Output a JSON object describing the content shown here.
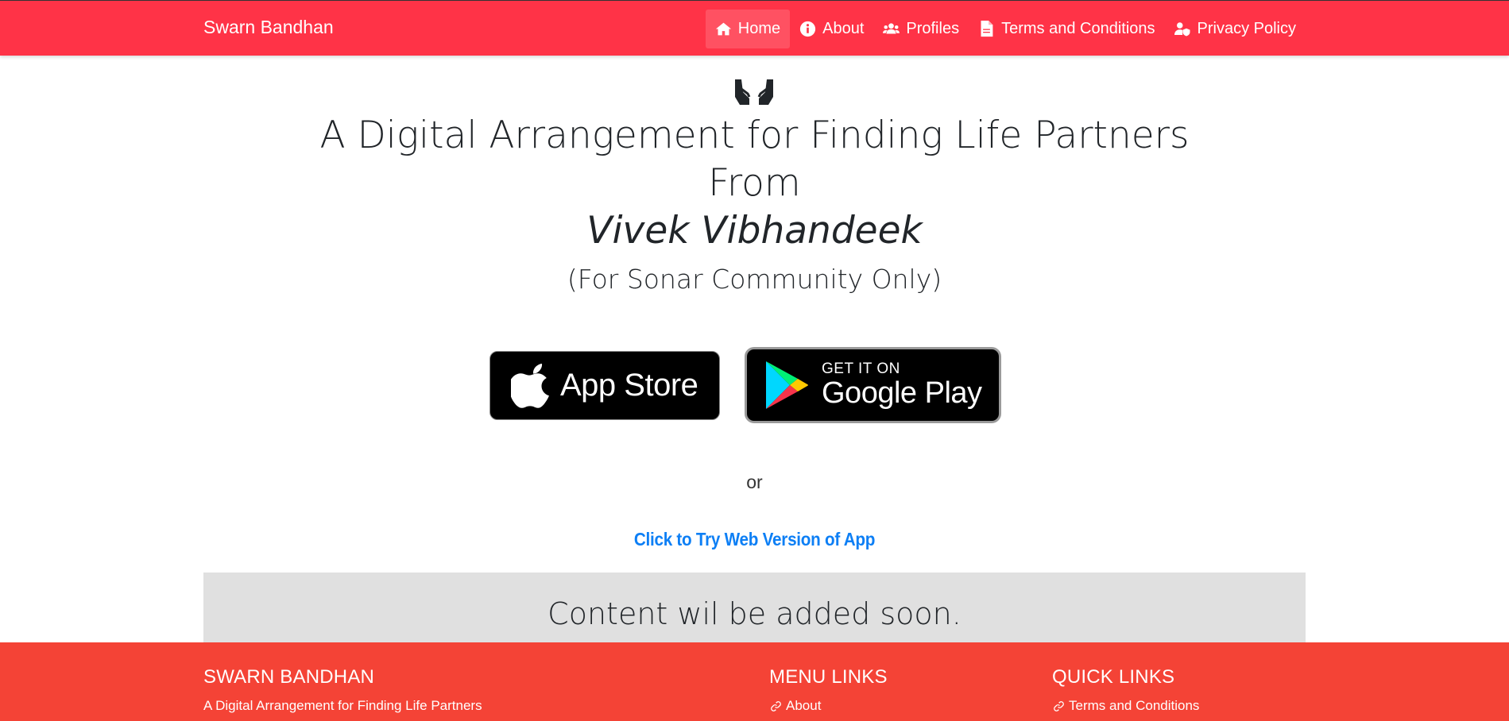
{
  "brand": "Swarn Bandhan",
  "nav": [
    {
      "label": "Home",
      "icon": "home-icon",
      "active": true
    },
    {
      "label": "About",
      "icon": "info-icon"
    },
    {
      "label": "Profiles",
      "icon": "users-icon"
    },
    {
      "label": "Terms and Conditions",
      "icon": "document-icon"
    },
    {
      "label": "Privacy Policy",
      "icon": "user-shield-icon"
    }
  ],
  "hero": {
    "line1": "A Digital Arrangement for Finding Life Partners",
    "line2": "From",
    "line3": "Vivek Vibhandeek",
    "line4": "(For Sonar Community Only)"
  },
  "badges": {
    "appstore": "App Store",
    "play_small": "GET IT ON",
    "play_big": "Google Play"
  },
  "or_text": "or",
  "web_link": "Click to Try Web Version of App",
  "content_placeholder": "Content wil be added soon.",
  "footer": {
    "col1_heading": "SWARN BANDHAN",
    "col1_text": "A Digital Arrangement for Finding Life Partners",
    "col2_heading": "MENU LINKS",
    "col2_link": "About",
    "col3_heading": "QUICK LINKS",
    "col3_link": "Terms and Conditions"
  },
  "colors": {
    "navbar": "#ff3347",
    "footer": "#f44336",
    "link": "#0d7ff5",
    "content_box": "#e0e0e0"
  }
}
